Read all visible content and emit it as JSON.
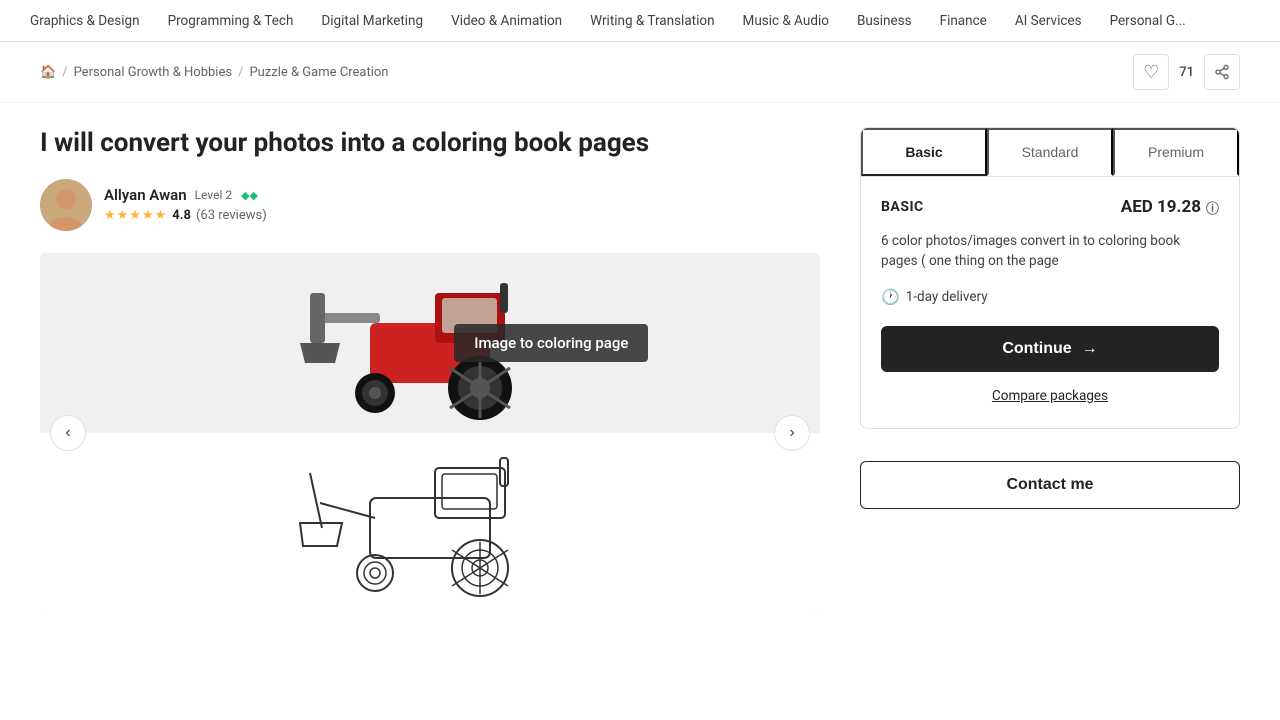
{
  "nav": {
    "items": [
      "Graphics & Design",
      "Programming & Tech",
      "Digital Marketing",
      "Video & Animation",
      "Writing & Translation",
      "Music & Audio",
      "Business",
      "Finance",
      "AI Services",
      "Personal G..."
    ]
  },
  "breadcrumb": {
    "home_icon": "🏠",
    "separator": "/",
    "crumb1": "Personal Growth & Hobbies",
    "crumb2": "Puzzle & Game Creation"
  },
  "actions": {
    "like_count": "71"
  },
  "gig": {
    "title": "I will convert your photos into a coloring book pages"
  },
  "seller": {
    "name": "Allyan Awan",
    "level": "Level 2",
    "diamonds": "◆◆",
    "rating": "4.8",
    "stars": "★★★★★",
    "review_count": "63 reviews"
  },
  "carousel": {
    "image_label": "Image to coloring page",
    "prev_icon": "‹",
    "next_icon": "›"
  },
  "packages": {
    "tabs": [
      "Basic",
      "Standard",
      "Premium"
    ],
    "active_tab": "Basic",
    "basic": {
      "name": "BASIC",
      "price": "AED 19.28",
      "description": "6 color photos/images convert in to coloring book pages ( one thing on the page",
      "delivery": "1-day delivery"
    }
  },
  "buttons": {
    "continue": "Continue",
    "continue_arrow": "→",
    "compare": "Compare packages",
    "contact": "Contact me"
  }
}
